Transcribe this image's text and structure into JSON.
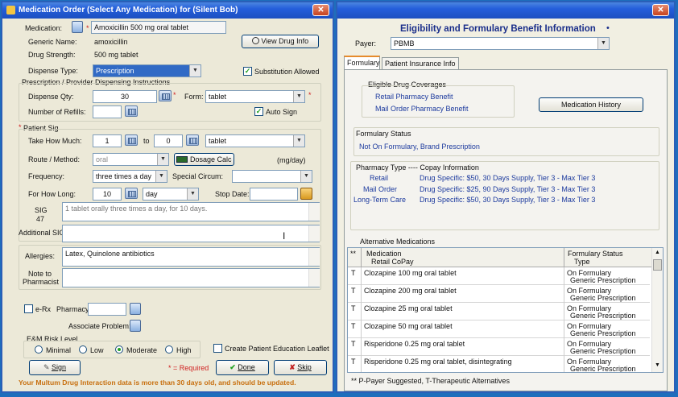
{
  "left_window": {
    "title": "Medication Order (Select Any Medication) for (Silent Bob)",
    "medication_label": "Medication:",
    "medication_value": "Amoxicillin 500 mg oral tablet",
    "generic_name_label": "Generic Name:",
    "generic_name_value": "amoxicillin",
    "view_drug_info_label": "View Drug Info",
    "drug_strength_label": "Drug Strength:",
    "drug_strength_value": "500 mg tablet",
    "dispense_type_label": "Dispense Type:",
    "dispense_type_value": "Prescription",
    "substitution_label": "Substitution Allowed",
    "dispensing_section_label": "Prescription / Provider Dispensing Instructions",
    "dispense_qty_label": "Dispense Qty:",
    "dispense_qty_value": "30",
    "form_label": "Form:",
    "form_value": "tablet",
    "refills_label": "Number of Refills:",
    "refills_value": "",
    "auto_sign_label": "Auto Sign",
    "patient_sig_label": "Patient Sig",
    "take_how_much_label": "Take How Much:",
    "take_from_value": "1",
    "to_label": "to",
    "take_to_value": "0",
    "take_unit_value": "tablet",
    "route_label": "Route / Method:",
    "route_value": "oral",
    "dosage_calc_label": "Dosage Calc",
    "mg_day_label": "(mg/day)",
    "frequency_label": "Frequency:",
    "frequency_value": "three times a day",
    "special_circum_label": "Special Circum:",
    "special_circum_value": "",
    "for_how_long_label": "For How Long:",
    "for_how_long_value": "10",
    "duration_unit_value": "day",
    "stop_date_label": "Stop Date:",
    "stop_date_value": "",
    "sig_label": "SIG",
    "sig_count": "47",
    "sig_text": "1 tablet orally three times a day, for 10 days.",
    "additional_sig_label": "Additional SIG:",
    "allergies_label": "Allergies:",
    "allergies_value": "Latex, Quinolone antibiotics",
    "note_label_line1": "Note to",
    "note_label_line2": "Pharmacist",
    "erx_label": "e-Rx",
    "pharmacy_label": "Pharmacy:",
    "associate_problem_label": "Associate Problem:",
    "em_risk_label": "E&M Risk Level",
    "risk_minimal": "Minimal",
    "risk_low": "Low",
    "risk_moderate": "Moderate",
    "risk_high": "High",
    "create_leaflet_label": "Create Patient Education Leaflet",
    "sign_label": "Sign",
    "required_label": "* = Required",
    "done_label": "Done",
    "skip_label": "Skip",
    "warning": "Your Multum Drug Interaction data is more than 30 days old, and should be updated."
  },
  "right_window": {
    "heading": "Eligibility and Formulary Benefit Information",
    "payer_label": "Payer:",
    "payer_value": "PBMB",
    "tabs": [
      "Formulary",
      "Patient Insurance Info"
    ],
    "eligible_label": "Eligible Drug Coverages",
    "coverage_retail": "Retail Pharmacy Benefit",
    "coverage_mail": "Mail Order Pharmacy Benefit",
    "medication_history_label": "Medication History",
    "formulary_status_label": "Formulary Status",
    "formulary_status_value": "Not On Formulary, Brand Prescription",
    "pharmacy_type_label": "Pharmacy Type ---- Copay Information",
    "copay_rows": [
      {
        "type": "Retail",
        "info": "Drug Specific: $50, 30 Days Supply, Tier 3 - Max Tier 3"
      },
      {
        "type": "Mail Order",
        "info": "Drug Specific: $25, 90 Days Supply, Tier 3 - Max Tier 3"
      },
      {
        "type": "Long-Term Care",
        "info": "Drug Specific: $50, 30 Days Supply, Tier 3 - Max Tier 3"
      }
    ],
    "alternatives_label": "Alternative Medications",
    "table_headers": {
      "flag": "**",
      "medication": "Medication",
      "retail_copay": "Retail CoPay",
      "formulary_status": "Formulary Status",
      "type": "Type"
    },
    "alternatives": [
      {
        "flag": "T",
        "name": "Clozapine 100 mg oral tablet",
        "status": "On Formulary",
        "type": "Generic Prescription"
      },
      {
        "flag": "T",
        "name": "Clozapine 200 mg oral tablet",
        "status": "On Formulary",
        "type": "Generic Prescription"
      },
      {
        "flag": "T",
        "name": "Clozapine 25 mg oral tablet",
        "status": "On Formulary",
        "type": "Generic Prescription"
      },
      {
        "flag": "T",
        "name": "Clozapine 50 mg oral tablet",
        "status": "On Formulary",
        "type": "Generic Prescription"
      },
      {
        "flag": "T",
        "name": "Risperidone 0.25 mg oral tablet",
        "status": "On Formulary",
        "type": "Generic Prescription"
      },
      {
        "flag": "T",
        "name": "Risperidone 0.25 mg oral tablet, disintegrating",
        "status": "On Formulary",
        "type": "Generic Prescription"
      }
    ],
    "footnote": "** P-Payer Suggested,  T-Therapeutic Alternatives"
  },
  "colors": {
    "titlebar": "#245edb",
    "window_bg": "#ece9d8",
    "link_blue": "#1c3a9e",
    "required_red": "#d02020",
    "warning_orange": "#c87010"
  }
}
